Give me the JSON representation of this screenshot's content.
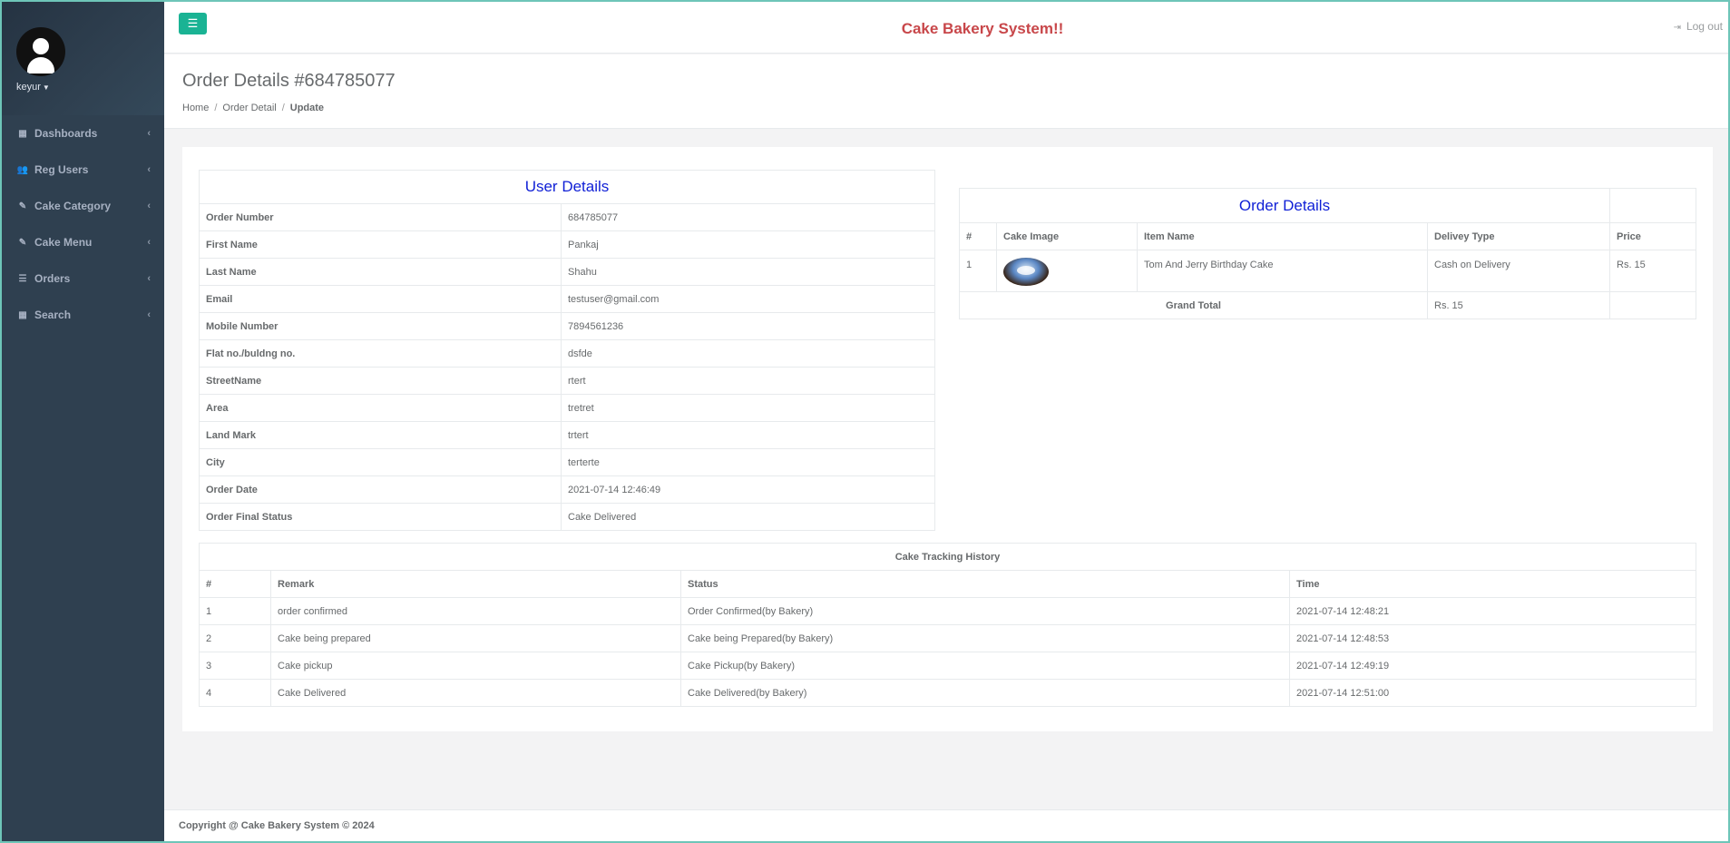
{
  "sidebar": {
    "username": "keyur",
    "items": [
      {
        "label": "Dashboards",
        "icon": "th-large-icon"
      },
      {
        "label": "Reg Users",
        "icon": "users-icon"
      },
      {
        "label": "Cake Category",
        "icon": "edit-icon"
      },
      {
        "label": "Cake Menu",
        "icon": "edit-icon"
      },
      {
        "label": "Orders",
        "icon": "list-icon"
      },
      {
        "label": "Search",
        "icon": "th-large-icon"
      }
    ]
  },
  "topbar": {
    "title": "Cake Bakery System!!",
    "logout": "Log out"
  },
  "heading": {
    "title": "Order Details #684785077",
    "breadcrumb": [
      "Home",
      "Order Detail",
      "Update"
    ]
  },
  "user_details": {
    "title": "User Details",
    "rows": [
      {
        "label": "Order Number",
        "value": "684785077"
      },
      {
        "label": "First Name",
        "value": "Pankaj"
      },
      {
        "label": "Last Name",
        "value": "Shahu"
      },
      {
        "label": "Email",
        "value": "testuser@gmail.com"
      },
      {
        "label": "Mobile Number",
        "value": "7894561236"
      },
      {
        "label": "Flat no./buldng no.",
        "value": "dsfde"
      },
      {
        "label": "StreetName",
        "value": "rtert"
      },
      {
        "label": "Area",
        "value": "tretret"
      },
      {
        "label": "Land Mark",
        "value": "trtert"
      },
      {
        "label": "City",
        "value": "terterte"
      },
      {
        "label": "Order Date",
        "value": "2021-07-14 12:46:49"
      },
      {
        "label": "Order Final Status",
        "value": "Cake Delivered"
      }
    ]
  },
  "order_details": {
    "title": "Order Details",
    "headers": [
      "#",
      "Cake Image",
      "Item Name",
      "Delivey Type",
      "Price"
    ],
    "items": [
      {
        "num": "1",
        "item_name": "Tom And Jerry Birthday Cake",
        "delivery_type": "Cash on Delivery",
        "price": "Rs. 15"
      }
    ],
    "grand_total_label": "Grand Total",
    "grand_total_value": "Rs. 15"
  },
  "tracking": {
    "title": "Cake Tracking History",
    "headers": [
      "#",
      "Remark",
      "Status",
      "Time"
    ],
    "rows": [
      {
        "num": "1",
        "remark": "order confirmed",
        "status": "Order Confirmed(by Bakery)",
        "time": "2021-07-14 12:48:21"
      },
      {
        "num": "2",
        "remark": "Cake being prepared",
        "status": "Cake being Prepared(by Bakery)",
        "time": "2021-07-14 12:48:53"
      },
      {
        "num": "3",
        "remark": "Cake pickup",
        "status": "Cake Pickup(by Bakery)",
        "time": "2021-07-14 12:49:19"
      },
      {
        "num": "4",
        "remark": "Cake Delivered",
        "status": "Cake Delivered(by Bakery)",
        "time": "2021-07-14 12:51:00"
      }
    ]
  },
  "footer": {
    "text": "Copyright @ Cake Bakery System © 2024"
  },
  "colors": {
    "sidebar": "#2f4050",
    "accent": "#1ab394",
    "title_red": "#c8474a",
    "section_title_blue": "#0f1fd6"
  }
}
